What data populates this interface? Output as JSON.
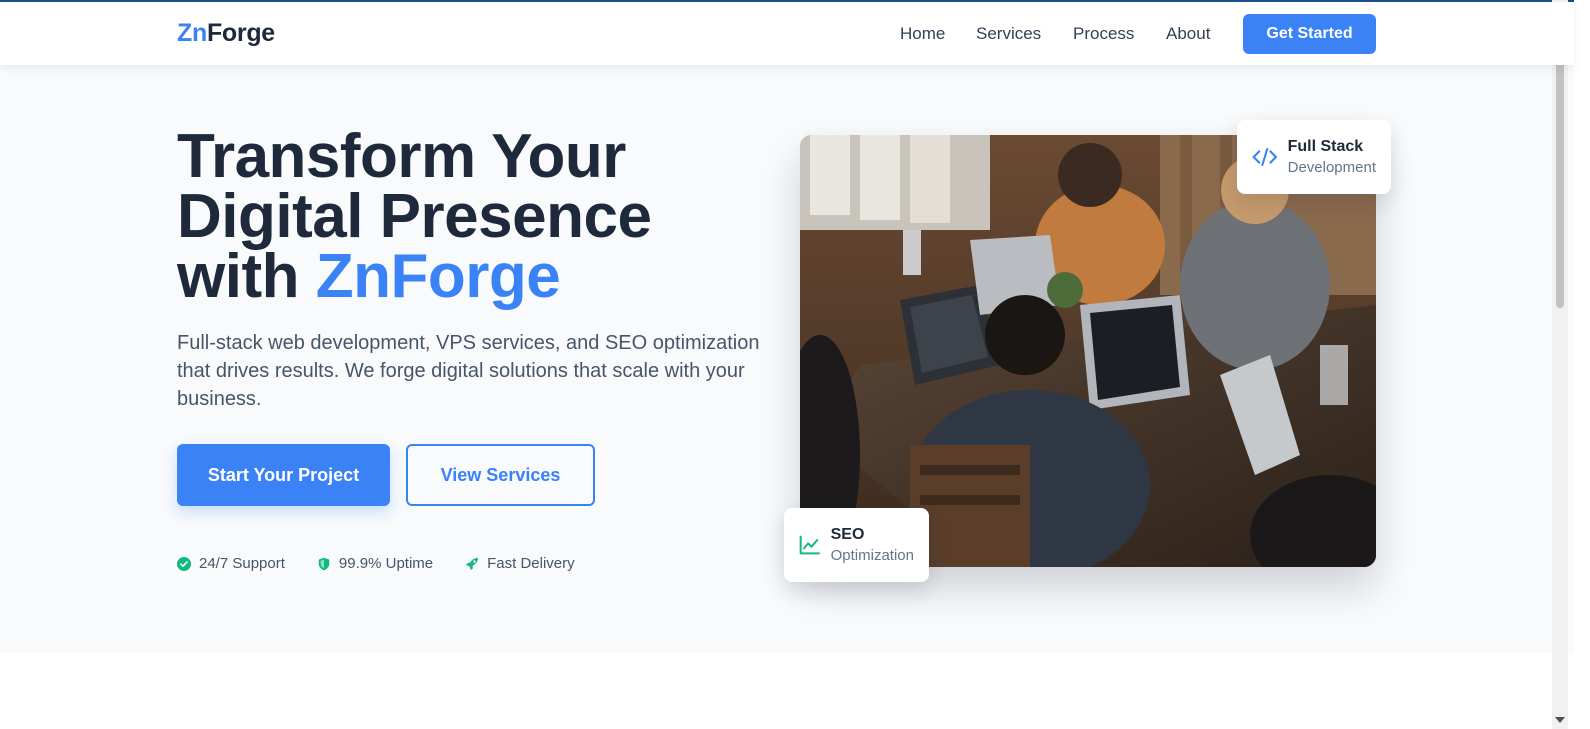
{
  "nav": {
    "logo_part1": "Zn",
    "logo_part2": "Forge",
    "links": [
      "Home",
      "Services",
      "Process",
      "About"
    ],
    "cta": "Get Started"
  },
  "hero": {
    "headline_line1": "Transform Your",
    "headline_line2": "Digital Presence",
    "headline_line3_prefix": "with ",
    "headline_accent": "ZnForge",
    "subtext": "Full-stack web development, VPS services, and SEO optimization that drives results. We forge digital solutions that scale with your business.",
    "primary_button": "Start Your Project",
    "secondary_button": "View Services",
    "features": [
      {
        "icon": "check-circle-icon",
        "label": "24/7 Support"
      },
      {
        "icon": "shield-icon",
        "label": "99.9% Uptime"
      },
      {
        "icon": "rocket-icon",
        "label": "Fast Delivery"
      }
    ]
  },
  "cards": {
    "fullstack": {
      "icon": "code-icon",
      "title": "Full Stack",
      "subtitle": "Development"
    },
    "seo": {
      "icon": "chart-line-icon",
      "title": "SEO",
      "subtitle": "Optimization"
    }
  },
  "colors": {
    "accent": "#3b82f6",
    "text_dark": "#1e293b",
    "text_muted": "#475569",
    "feature_green": "#10b981",
    "hero_bg": "#f8fafc"
  }
}
